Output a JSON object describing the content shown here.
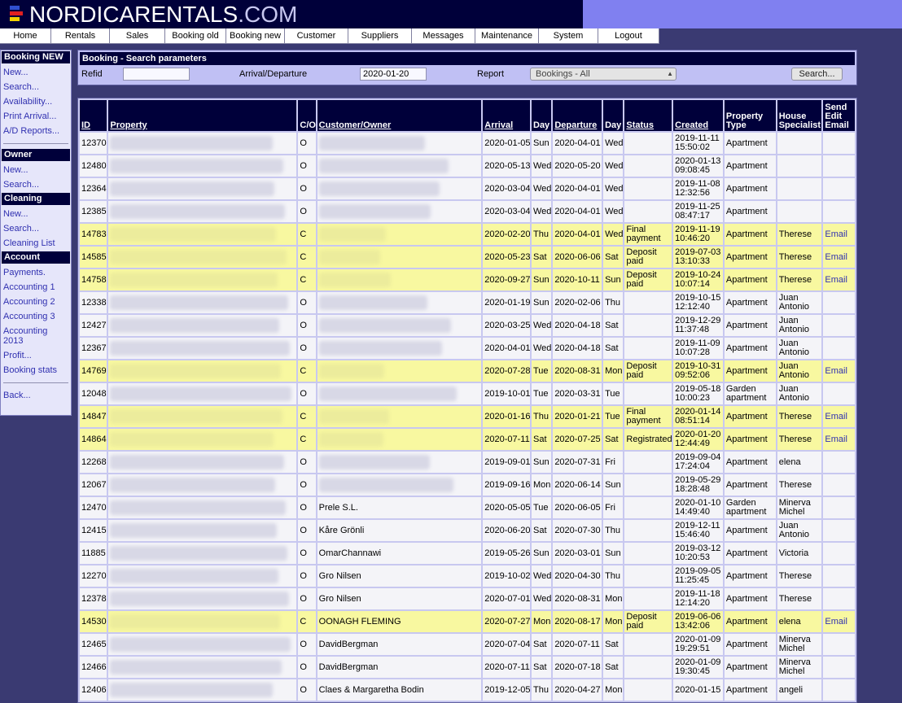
{
  "logo": {
    "main": "NORDICARENTALS",
    "suffix": ".COM"
  },
  "nav": [
    {
      "label": "Home",
      "w": 63
    },
    {
      "label": "Rentals",
      "w": 72
    },
    {
      "label": "Sales",
      "w": 68
    },
    {
      "label": "Booking old",
      "w": 75
    },
    {
      "label": "Booking new",
      "w": 72
    },
    {
      "label": "Customer",
      "w": 78
    },
    {
      "label": "Suppliers",
      "w": 78
    },
    {
      "label": "Messages",
      "w": 78
    },
    {
      "label": "Maintenance",
      "w": 78
    },
    {
      "label": "System",
      "w": 73
    },
    {
      "label": "Logout",
      "w": 75
    }
  ],
  "sidebar": [
    {
      "type": "head",
      "label": "Booking NEW"
    },
    {
      "type": "link",
      "label": "New..."
    },
    {
      "type": "link",
      "label": "Search..."
    },
    {
      "type": "link",
      "label": "Availability..."
    },
    {
      "type": "link",
      "label": "Print Arrival..."
    },
    {
      "type": "link",
      "label": "A/D Reports..."
    },
    {
      "type": "sep"
    },
    {
      "type": "head",
      "label": "Owner"
    },
    {
      "type": "link",
      "label": "New..."
    },
    {
      "type": "link",
      "label": "Search..."
    },
    {
      "type": "head",
      "label": "Cleaning"
    },
    {
      "type": "link",
      "label": "New..."
    },
    {
      "type": "link",
      "label": "Search..."
    },
    {
      "type": "link",
      "label": "Cleaning List"
    },
    {
      "type": "head",
      "label": "Account"
    },
    {
      "type": "link",
      "label": "Payments."
    },
    {
      "type": "link",
      "label": "Accounting 1"
    },
    {
      "type": "link",
      "label": "Accounting 2"
    },
    {
      "type": "link",
      "label": "Accounting 3"
    },
    {
      "type": "link",
      "label": "Accounting 2013"
    },
    {
      "type": "link",
      "label": "Profit..."
    },
    {
      "type": "link",
      "label": "Booking stats"
    },
    {
      "type": "sep"
    },
    {
      "type": "link",
      "label": "Back..."
    }
  ],
  "search": {
    "title": "Booking - Search parameters",
    "refid_label": "Refid",
    "refid_value": "",
    "arrival_label": "Arrival/Departure",
    "arrival_value": "2020-01-20",
    "report_label": "Report",
    "report_value": "Bookings - All",
    "search_button": "Search..."
  },
  "table": {
    "columns": [
      {
        "label": "ID",
        "sortable": true,
        "w": 33
      },
      {
        "label": "Property",
        "sortable": true,
        "w": 228
      },
      {
        "label": "C/O",
        "sortable": false,
        "w": 21
      },
      {
        "label": "Customer/Owner",
        "sortable": true,
        "w": 199
      },
      {
        "label": "Arrival",
        "sortable": true,
        "w": 57
      },
      {
        "label": "Day",
        "sortable": false,
        "w": 24
      },
      {
        "label": "Departure",
        "sortable": true,
        "w": 59
      },
      {
        "label": "Day",
        "sortable": false,
        "w": 24
      },
      {
        "label": "Status",
        "sortable": true,
        "w": 57
      },
      {
        "label": "Created",
        "sortable": true,
        "w": 60
      },
      {
        "label": "Property Type",
        "sortable": false,
        "w": 62
      },
      {
        "label": "House Specialist",
        "sortable": false,
        "w": 54
      },
      {
        "label": "Send Edit Email",
        "sortable": false,
        "w": 38
      }
    ],
    "rows": [
      {
        "id": "12370",
        "co": "O",
        "customer": "",
        "arrival": "2020-01-05",
        "aday": "Sun",
        "departure": "2020-04-01",
        "dday": "Wed",
        "status": "",
        "created": "2019-11-11 15:50:02",
        "ptype": "Apartment",
        "specialist": "",
        "email": "",
        "hl": false
      },
      {
        "id": "12480",
        "co": "O",
        "customer": "",
        "arrival": "2020-05-13",
        "aday": "Wed",
        "departure": "2020-05-20",
        "dday": "Wed",
        "status": "",
        "created": "2020-01-13 09:08:45",
        "ptype": "Apartment",
        "specialist": "",
        "email": "",
        "hl": false
      },
      {
        "id": "12364",
        "co": "O",
        "customer": "",
        "arrival": "2020-03-04",
        "aday": "Wed",
        "departure": "2020-04-01",
        "dday": "Wed",
        "status": "",
        "created": "2019-11-08 12:32:56",
        "ptype": "Apartment",
        "specialist": "",
        "email": "",
        "hl": false
      },
      {
        "id": "12385",
        "co": "O",
        "customer": "",
        "arrival": "2020-03-04",
        "aday": "Wed",
        "departure": "2020-04-01",
        "dday": "Wed",
        "status": "",
        "created": "2019-11-25 08:47:17",
        "ptype": "Apartment",
        "specialist": "",
        "email": "",
        "hl": false
      },
      {
        "id": "14783",
        "co": "C",
        "customer": "",
        "arrival": "2020-02-20",
        "aday": "Thu",
        "departure": "2020-04-01",
        "dday": "Wed",
        "status": "Final payment",
        "created": "2019-11-19 10:46:20",
        "ptype": "Apartment",
        "specialist": "Therese",
        "email": "Email",
        "hl": true
      },
      {
        "id": "14585",
        "co": "C",
        "customer": "",
        "arrival": "2020-05-23",
        "aday": "Sat",
        "departure": "2020-06-06",
        "dday": "Sat",
        "status": "Deposit paid",
        "created": "2019-07-03 13:10:33",
        "ptype": "Apartment",
        "specialist": "Therese",
        "email": "Email",
        "hl": true
      },
      {
        "id": "14758",
        "co": "C",
        "customer": "",
        "arrival": "2020-09-27",
        "aday": "Sun",
        "departure": "2020-10-11",
        "dday": "Sun",
        "status": "Deposit paid",
        "created": "2019-10-24 10:07:14",
        "ptype": "Apartment",
        "specialist": "Therese",
        "email": "Email",
        "hl": true
      },
      {
        "id": "12338",
        "co": "O",
        "customer": "",
        "arrival": "2020-01-19",
        "aday": "Sun",
        "departure": "2020-02-06",
        "dday": "Thu",
        "status": "",
        "created": "2019-10-15 12:12:40",
        "ptype": "Apartment",
        "specialist": "Juan Antonio",
        "email": "",
        "hl": false
      },
      {
        "id": "12427",
        "co": "O",
        "customer": "",
        "arrival": "2020-03-25",
        "aday": "Wed",
        "departure": "2020-04-18",
        "dday": "Sat",
        "status": "",
        "created": "2019-12-29 11:37:48",
        "ptype": "Apartment",
        "specialist": "Juan Antonio",
        "email": "",
        "hl": false
      },
      {
        "id": "12367",
        "co": "O",
        "customer": "",
        "arrival": "2020-04-01",
        "aday": "Wed",
        "departure": "2020-04-18",
        "dday": "Sat",
        "status": "",
        "created": "2019-11-09 10:07:28",
        "ptype": "Apartment",
        "specialist": "Juan Antonio",
        "email": "",
        "hl": false
      },
      {
        "id": "14769",
        "co": "C",
        "customer": "",
        "arrival": "2020-07-28",
        "aday": "Tue",
        "departure": "2020-08-31",
        "dday": "Mon",
        "status": "Deposit paid",
        "created": "2019-10-31 09:52:06",
        "ptype": "Apartment",
        "specialist": "Juan Antonio",
        "email": "Email",
        "hl": true
      },
      {
        "id": "12048",
        "co": "O",
        "customer": "",
        "arrival": "2019-10-01",
        "aday": "Tue",
        "departure": "2020-03-31",
        "dday": "Tue",
        "status": "",
        "created": "2019-05-18 10:00:23",
        "ptype": "Garden apartment",
        "specialist": "Juan Antonio",
        "email": "",
        "hl": false
      },
      {
        "id": "14847",
        "co": "C",
        "customer": "",
        "arrival": "2020-01-16",
        "aday": "Thu",
        "departure": "2020-01-21",
        "dday": "Tue",
        "status": "Final payment",
        "created": "2020-01-14 08:51:14",
        "ptype": "Apartment",
        "specialist": "Therese",
        "email": "Email",
        "hl": true
      },
      {
        "id": "14864",
        "co": "C",
        "customer": "",
        "arrival": "2020-07-11",
        "aday": "Sat",
        "departure": "2020-07-25",
        "dday": "Sat",
        "status": "Registrated",
        "created": "2020-01-20 12:44:49",
        "ptype": "Apartment",
        "specialist": "Therese",
        "email": "Email",
        "hl": true
      },
      {
        "id": "12268",
        "co": "O",
        "customer": "",
        "arrival": "2019-09-01",
        "aday": "Sun",
        "departure": "2020-07-31",
        "dday": "Fri",
        "status": "",
        "created": "2019-09-04 17:24:04",
        "ptype": "Apartment",
        "specialist": "elena",
        "email": "",
        "hl": false
      },
      {
        "id": "12067",
        "co": "O",
        "customer": "",
        "arrival": "2019-09-16",
        "aday": "Mon",
        "departure": "2020-06-14",
        "dday": "Sun",
        "status": "",
        "created": "2019-05-29 18:28:48",
        "ptype": "Apartment",
        "specialist": "Therese",
        "email": "",
        "hl": false
      },
      {
        "id": "12470",
        "co": "O",
        "customer": "Prele S.L.",
        "arrival": "2020-05-05",
        "aday": "Tue",
        "departure": "2020-06-05",
        "dday": "Fri",
        "status": "",
        "created": "2020-01-10 14:49:40",
        "ptype": "Garden apartment",
        "specialist": "Minerva Michel",
        "email": "",
        "hl": false
      },
      {
        "id": "12415",
        "co": "O",
        "customer": "Kåre Grönli",
        "arrival": "2020-06-20",
        "aday": "Sat",
        "departure": "2020-07-30",
        "dday": "Thu",
        "status": "",
        "created": "2019-12-11 15:46:40",
        "ptype": "Apartment",
        "specialist": "Juan Antonio",
        "email": "",
        "hl": false
      },
      {
        "id": "11885",
        "co": "O",
        "customer": "OmarChannawi",
        "arrival": "2019-05-26",
        "aday": "Sun",
        "departure": "2020-03-01",
        "dday": "Sun",
        "status": "",
        "created": "2019-03-12 10:20:53",
        "ptype": "Apartment",
        "specialist": "Victoria",
        "email": "",
        "hl": false
      },
      {
        "id": "12270",
        "co": "O",
        "customer": "Gro Nilsen",
        "arrival": "2019-10-02",
        "aday": "Wed",
        "departure": "2020-04-30",
        "dday": "Thu",
        "status": "",
        "created": "2019-09-05 11:25:45",
        "ptype": "Apartment",
        "specialist": "Therese",
        "email": "",
        "hl": false
      },
      {
        "id": "12378",
        "co": "O",
        "customer": "Gro Nilsen",
        "arrival": "2020-07-01",
        "aday": "Wed",
        "departure": "2020-08-31",
        "dday": "Mon",
        "status": "",
        "created": "2019-11-18 12:14:20",
        "ptype": "Apartment",
        "specialist": "Therese",
        "email": "",
        "hl": false
      },
      {
        "id": "14530",
        "co": "C",
        "customer": "OONAGH FLEMING",
        "arrival": "2020-07-27",
        "aday": "Mon",
        "departure": "2020-08-17",
        "dday": "Mon",
        "status": "Deposit paid",
        "created": "2019-06-06 13:42:06",
        "ptype": "Apartment",
        "specialist": "elena",
        "email": "Email",
        "hl": true
      },
      {
        "id": "12465",
        "co": "O",
        "customer": "DavidBergman",
        "arrival": "2020-07-04",
        "aday": "Sat",
        "departure": "2020-07-11",
        "dday": "Sat",
        "status": "",
        "created": "2020-01-09 19:29:51",
        "ptype": "Apartment",
        "specialist": "Minerva Michel",
        "email": "",
        "hl": false
      },
      {
        "id": "12466",
        "co": "O",
        "customer": "DavidBergman",
        "arrival": "2020-07-11",
        "aday": "Sat",
        "departure": "2020-07-18",
        "dday": "Sat",
        "status": "",
        "created": "2020-01-09 19:30:45",
        "ptype": "Apartment",
        "specialist": "Minerva Michel",
        "email": "",
        "hl": false
      },
      {
        "id": "12406",
        "co": "O",
        "customer": "Claes & Margaretha Bodin",
        "arrival": "2019-12-05",
        "aday": "Thu",
        "departure": "2020-04-27",
        "dday": "Mon",
        "status": "",
        "created": "2020-01-15",
        "ptype": "Apartment",
        "specialist": "angeli",
        "email": "",
        "hl": false
      }
    ]
  }
}
